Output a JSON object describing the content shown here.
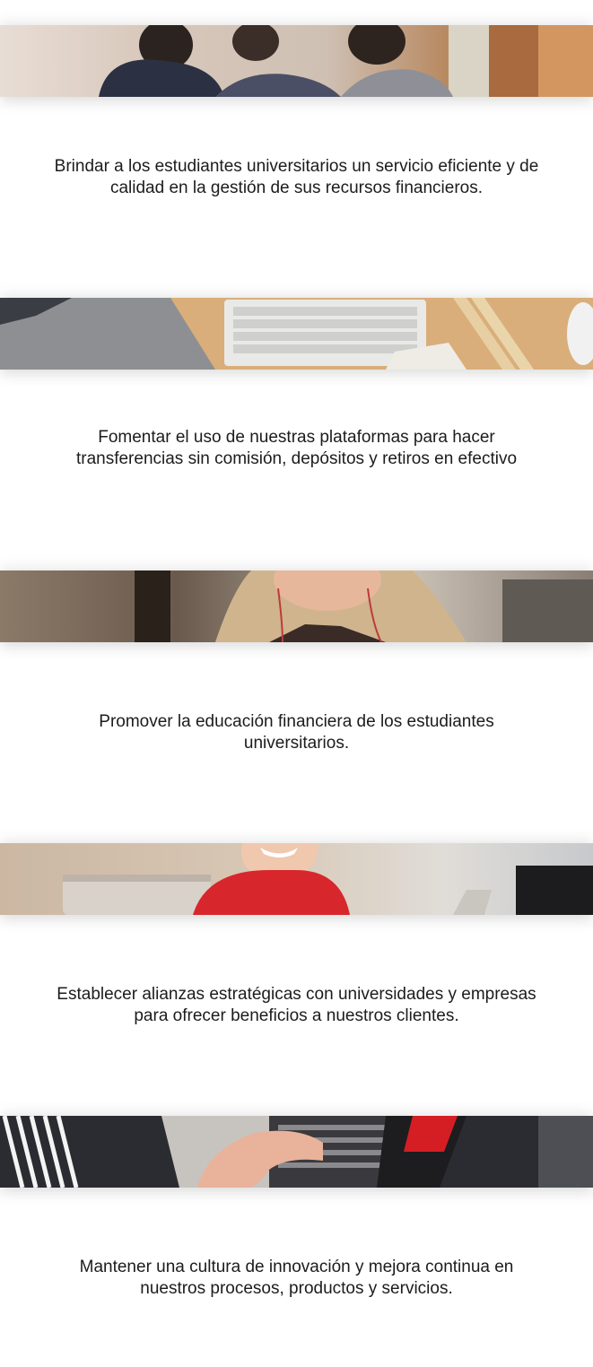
{
  "objectives": [
    {
      "text": "Brindar a los estudiantes universitarios un servicio eficiente y de calidad en la gestión de sus recursos financieros."
    },
    {
      "text": "Fomentar el uso de nuestras plataformas para hacer transferencias sin comisión, depósitos y retiros en efectivo"
    },
    {
      "text": "Promover la educación financiera de los estudiantes universitarios."
    },
    {
      "text": "Establecer alianzas estratégicas con universidades y empresas para ofrecer beneficios a nuestros clientes."
    },
    {
      "text": "Mantener una cultura de innovación y mejora continua en nuestros procesos, productos y servicios."
    }
  ]
}
